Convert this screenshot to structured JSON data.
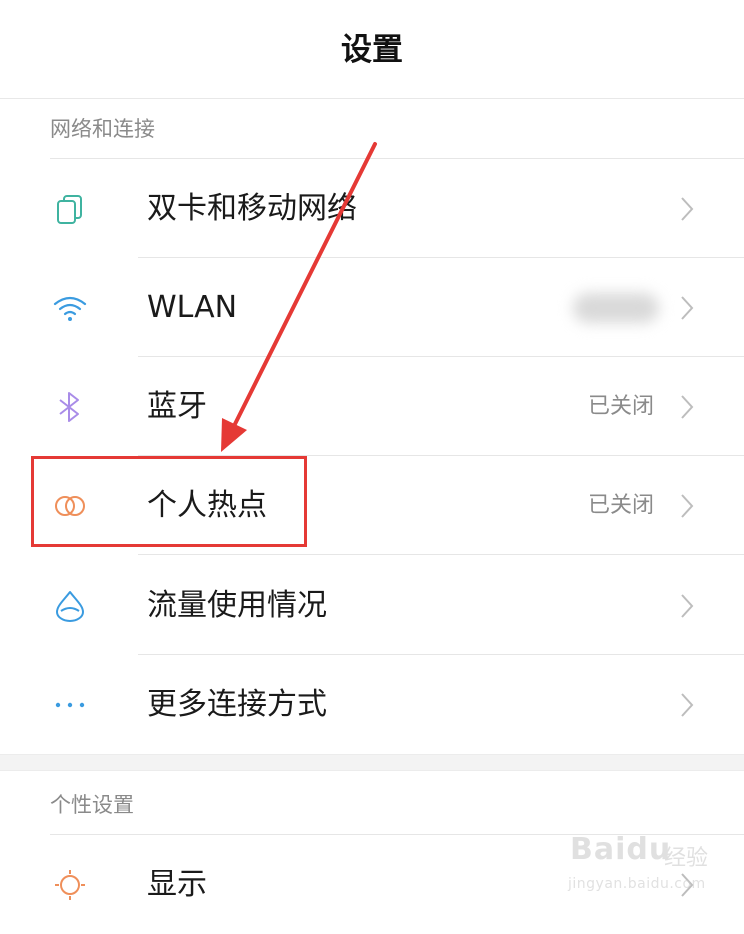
{
  "header": {
    "title": "设置"
  },
  "sections": [
    {
      "title": "网络和连接",
      "items": [
        {
          "label": "双卡和移动网络",
          "value": "",
          "icon": "sim-cards-icon"
        },
        {
          "label": "WLAN",
          "value": "",
          "icon": "wifi-icon"
        },
        {
          "label": "蓝牙",
          "value": "已关闭",
          "icon": "bluetooth-icon"
        },
        {
          "label": "个人热点",
          "value": "已关闭",
          "icon": "hotspot-icon"
        },
        {
          "label": "流量使用情况",
          "value": "",
          "icon": "data-drop-icon"
        },
        {
          "label": "更多连接方式",
          "value": "",
          "icon": "more-dots-icon"
        }
      ]
    },
    {
      "title": "个性设置",
      "items": [
        {
          "label": "显示",
          "value": "",
          "icon": "brightness-icon"
        }
      ]
    }
  ],
  "watermark": {
    "brand": "Baidu",
    "brand_cn": "经验",
    "url": "jingyan.baidu.com"
  },
  "colors": {
    "sim": "#3fb3a0",
    "wifi": "#3a9be0",
    "bluetooth": "#a98ce8",
    "hotspot": "#ef8f5a",
    "data": "#3a9be0",
    "more": "#3a9be0",
    "display": "#ef8f5a",
    "annotation": "#e53935"
  }
}
